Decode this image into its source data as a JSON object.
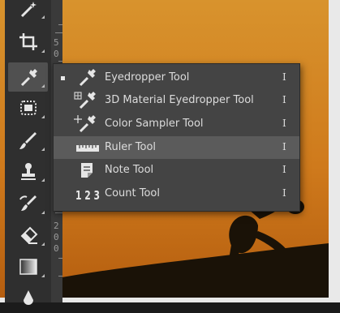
{
  "ruler": {
    "digits_top": [
      "5",
      "0"
    ],
    "digits_bottom": [
      "2",
      "0",
      "0"
    ]
  },
  "flyout": {
    "items": [
      {
        "label": "Eyedropper Tool",
        "shortcut": "I",
        "icon": "eyedropper-icon",
        "selected": true
      },
      {
        "label": "3D Material Eyedropper Tool",
        "shortcut": "I",
        "icon": "3d-material-eyedropper-icon"
      },
      {
        "label": "Color Sampler Tool",
        "shortcut": "I",
        "icon": "color-sampler-icon"
      },
      {
        "label": "Ruler Tool",
        "shortcut": "I",
        "icon": "ruler-icon",
        "hovered": true
      },
      {
        "label": "Note Tool",
        "shortcut": "I",
        "icon": "note-icon"
      },
      {
        "label": "Count Tool",
        "shortcut": "I",
        "icon": "count-icon",
        "icon_text": "1 2 3"
      }
    ]
  },
  "toolbar": {
    "tools": [
      "magic-wand-icon",
      "crop-icon",
      "eyedropper-icon",
      "healing-brush-icon",
      "brush-icon",
      "clone-stamp-icon",
      "history-brush-icon",
      "eraser-icon",
      "gradient-icon",
      "blur-icon"
    ],
    "active_tool": "eyedropper-icon"
  },
  "colors": {
    "sky_top": "#d58a24",
    "sky_bottom": "#c76a12",
    "silhouette": "#1a1207",
    "panel": "#444444",
    "highlight": "#5b5b5b",
    "toolbar": "#2f2f2f"
  }
}
